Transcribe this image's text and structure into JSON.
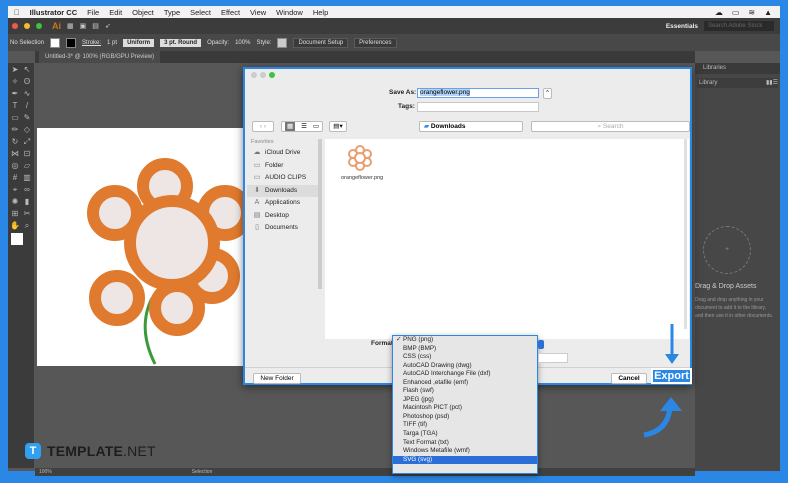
{
  "menubar": {
    "app": "Illustrator CC",
    "items": [
      "File",
      "Edit",
      "Object",
      "Type",
      "Select",
      "Effect",
      "View",
      "Window",
      "Help"
    ]
  },
  "appbar": {
    "logo": "Ai",
    "workspace": "Essentials",
    "search_placeholder": "Search Adobe Stock"
  },
  "control": {
    "selection": "No Selection",
    "stroke_label": "Stroke:",
    "stroke_value": "1 pt",
    "profile": "Uniform",
    "brush": "3 pt. Round",
    "opacity_label": "Opacity:",
    "opacity_value": "100%",
    "style_label": "Style:",
    "doc_setup": "Document Setup",
    "preferences": "Preferences"
  },
  "tab": {
    "title": "Untitled-3* @ 100% (RGB/GPU Preview)"
  },
  "panel": {
    "title": "Libraries",
    "library": "Library",
    "drag_title": "Drag & Drop Assets",
    "drag_desc": "Drag and drop anything in your document to add it to the library, and then use it in other documents."
  },
  "status": {
    "zoom": "100%",
    "tool": "Selection"
  },
  "dialog": {
    "save_as_label": "Save As:",
    "save_as_value": "orangeflower.png",
    "tags_label": "Tags:",
    "location": "Downloads",
    "search_placeholder": "Search",
    "favorites_label": "Favorites",
    "sidebar": [
      {
        "label": "iCloud Drive",
        "icon": "cloud-icon"
      },
      {
        "label": "Folder",
        "icon": "folder-icon"
      },
      {
        "label": "AUDIO CLIPS",
        "icon": "folder-icon"
      },
      {
        "label": "Downloads",
        "icon": "download-icon"
      },
      {
        "label": "Applications",
        "icon": "applications-icon"
      },
      {
        "label": "Desktop",
        "icon": "desktop-icon"
      },
      {
        "label": "Documents",
        "icon": "document-icon"
      }
    ],
    "file": "orangeflower.png",
    "format_label": "Format",
    "new_folder": "New Folder",
    "cancel": "Cancel",
    "export": "Export"
  },
  "format_options": [
    "PNG (png)",
    "BMP (BMP)",
    "CSS (css)",
    "AutoCAD Drawing (dwg)",
    "AutoCAD Interchange File (dxf)",
    "Enhanced ,etafile (emf)",
    "Flash (swf)",
    "JPEG (jpg)",
    "Macintosh PICT (pct)",
    "Photoshop (psd)",
    "TIFF (tif)",
    "Targa (TGA)",
    "Text Format (txt)",
    "Windows Metafile (wmf)",
    "SVG (svg)"
  ],
  "format_checked": "PNG (png)",
  "format_highlighted": "SVG (svg)",
  "watermark": {
    "brand": "TEMPLATE",
    "suffix": ".NET"
  },
  "colors": {
    "accent": "#2b87e6",
    "flower": "#e07a2e",
    "center": "#ede6e4"
  }
}
